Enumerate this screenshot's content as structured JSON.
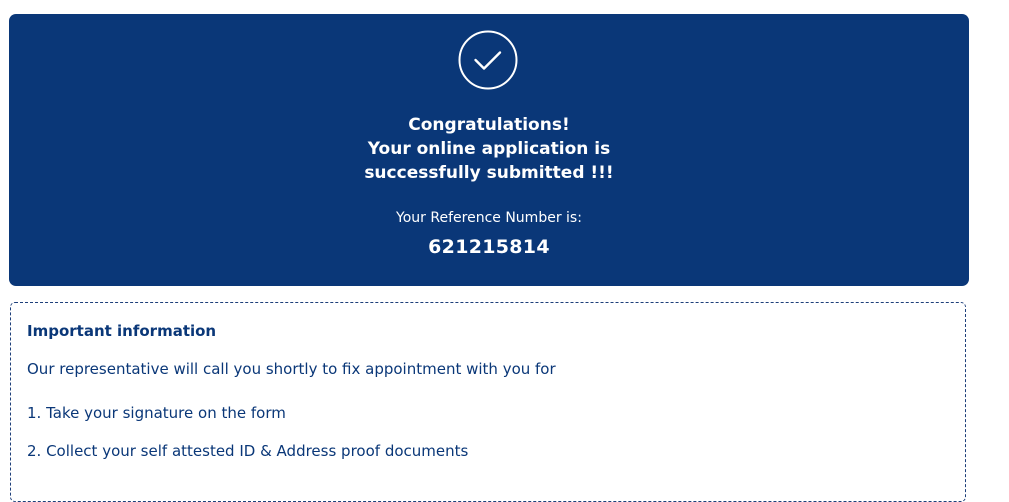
{
  "success": {
    "icon": "check-circle-icon",
    "congrats": "Congratulations!",
    "message_line1": "Your online application is",
    "message_line2": "successfully submitted !!!",
    "reference_label": "Your Reference Number is:",
    "reference_number": "621215814",
    "background_color": "#0a3778"
  },
  "info": {
    "title": "Important information",
    "intro": "Our representative will call you shortly to fix appointment with you for",
    "steps": [
      "1. Take your signature on the form",
      "2. Collect your self attested ID & Address proof documents"
    ]
  }
}
